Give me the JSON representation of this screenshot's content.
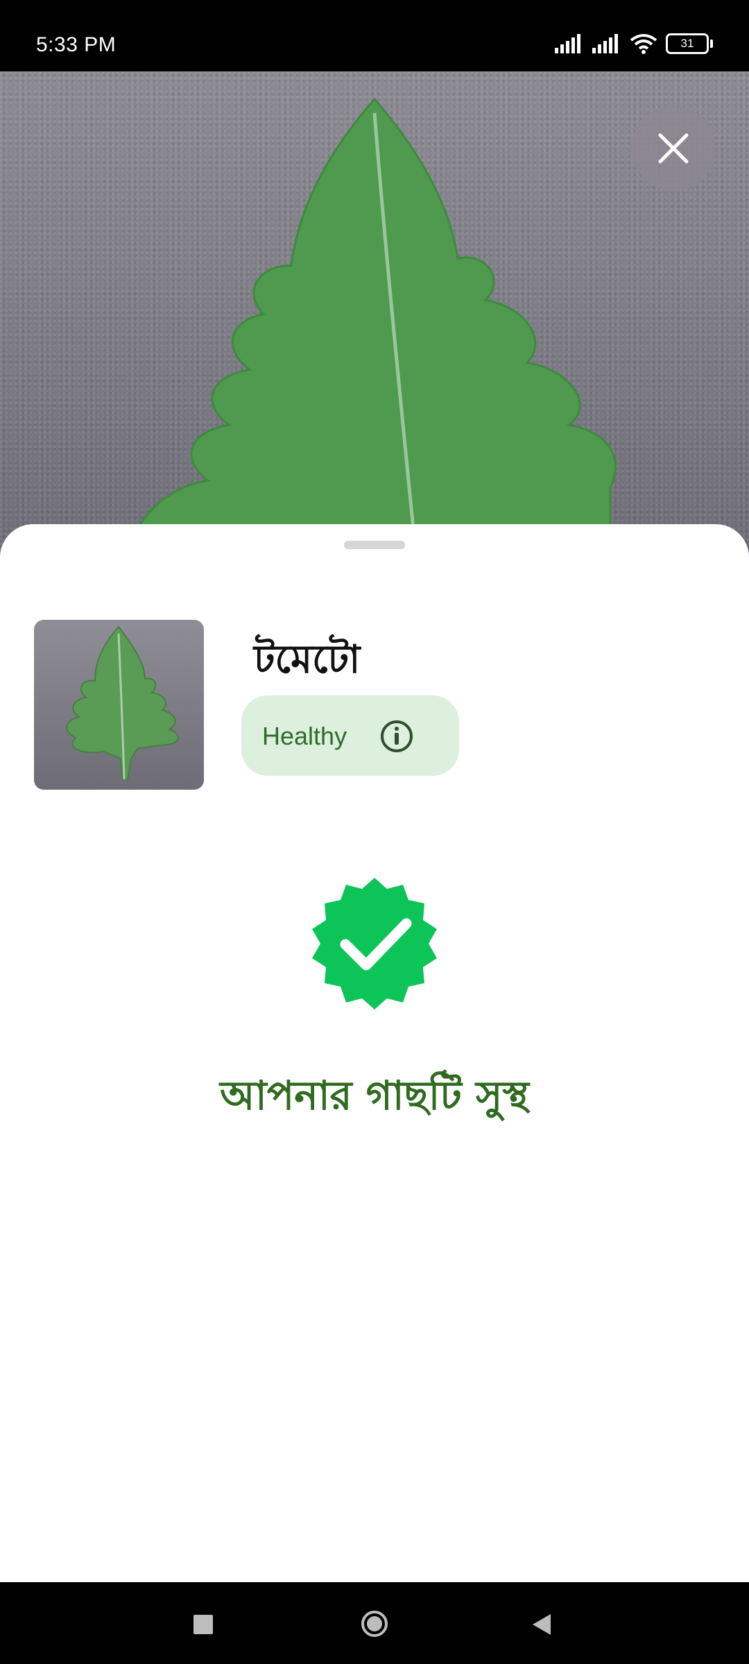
{
  "status_bar": {
    "time": "5:33 PM",
    "battery": "31"
  },
  "icons": {
    "close": "close-icon",
    "info": "info-icon",
    "badge": "verified-check-icon"
  },
  "result": {
    "plant_name": "টমেটো",
    "status_label": "Healthy",
    "message": "আপনার গাছটি সুস্থ"
  },
  "colors": {
    "badge_green": "#0dc458",
    "status_chip_bg": "#ddefdd",
    "status_text": "#2f6b2a",
    "message_text": "#2e6b1f"
  }
}
